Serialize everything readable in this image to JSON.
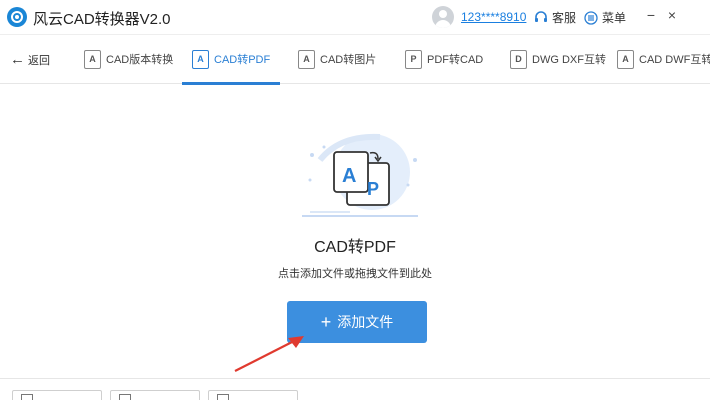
{
  "app": {
    "title": "风云CAD转换器V2.0"
  },
  "header": {
    "user_id": "123****8910",
    "service_label": "客服",
    "menu_label": "菜单",
    "minimize": "−",
    "close": "×"
  },
  "tabs": {
    "back_label": "返回",
    "items": [
      {
        "label": "CAD版本转换",
        "icon": "A"
      },
      {
        "label": "CAD转PDF",
        "icon": "A"
      },
      {
        "label": "CAD转图片",
        "icon": "A"
      },
      {
        "label": "PDF转CAD",
        "icon": "P"
      },
      {
        "label": "DWG DXF互转",
        "icon": "D"
      },
      {
        "label": "CAD DWF互转",
        "icon": "A"
      }
    ],
    "active_index": 1
  },
  "main": {
    "title": "CAD转PDF",
    "subtitle": "点击添加文件或拖拽文件到此处",
    "add_button_label": "添加文件",
    "add_button_icon": "+"
  },
  "colors": {
    "accent": "#2a7fd4",
    "button": "#3c8fdf",
    "arrow": "#e03a2f"
  }
}
